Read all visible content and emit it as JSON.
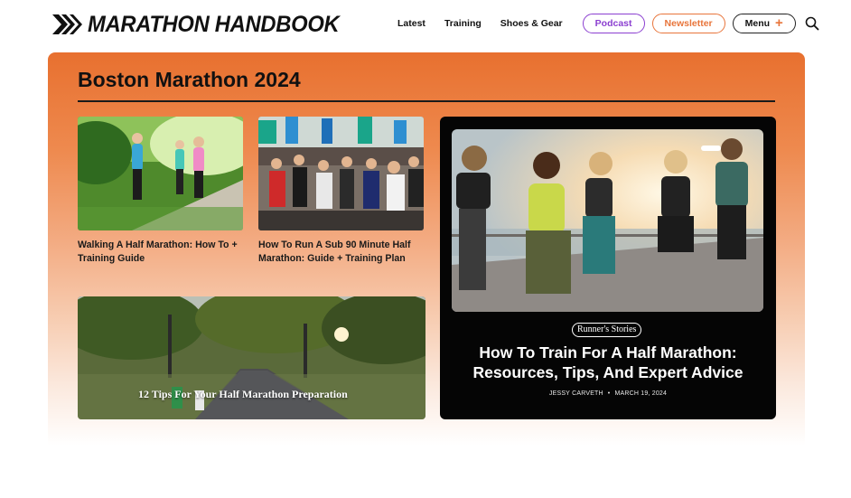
{
  "header": {
    "logo_text": "MARATHON HANDBOOK",
    "nav": [
      "Latest",
      "Training",
      "Shoes & Gear"
    ],
    "podcast_label": "Podcast",
    "newsletter_label": "Newsletter",
    "menu_label": "Menu",
    "menu_icon": "plus-icon",
    "search_icon": "search-icon"
  },
  "section": {
    "title": "Boston Marathon 2024",
    "cards": [
      {
        "title": "Walking A Half Marathon: How To + Training Guide"
      },
      {
        "title": "How To Run A Sub 90 Minute Half Marathon: Guide + Training Plan"
      }
    ],
    "feature": {
      "category": "Runner's Stories",
      "title": "How To Train For A Half Marathon: Resources, Tips, And Expert Advice",
      "author": "JESSY CARVETH",
      "date": "MARCH 19, 2024"
    },
    "wide_card": {
      "title": "12 Tips For Your Half Marathon Preparation"
    }
  },
  "colors": {
    "accent_orange": "#e8702f",
    "podcast_purple": "#8b3fd0",
    "newsletter_orange": "#e8753b"
  }
}
